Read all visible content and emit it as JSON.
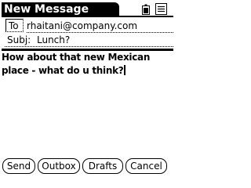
{
  "header": {
    "title": "New Message",
    "icons": [
      "battery-icon",
      "menu-icon"
    ]
  },
  "fields": {
    "to_label": "To",
    "to_value": "rhaitani@company.com",
    "subj_label": "Subj:",
    "subj_value": "Lunch?"
  },
  "body": {
    "text": "How about that new Mexican place - what do u think?"
  },
  "buttons": {
    "send": "Send",
    "outbox": "Outbox",
    "drafts": "Drafts",
    "cancel": "Cancel"
  }
}
